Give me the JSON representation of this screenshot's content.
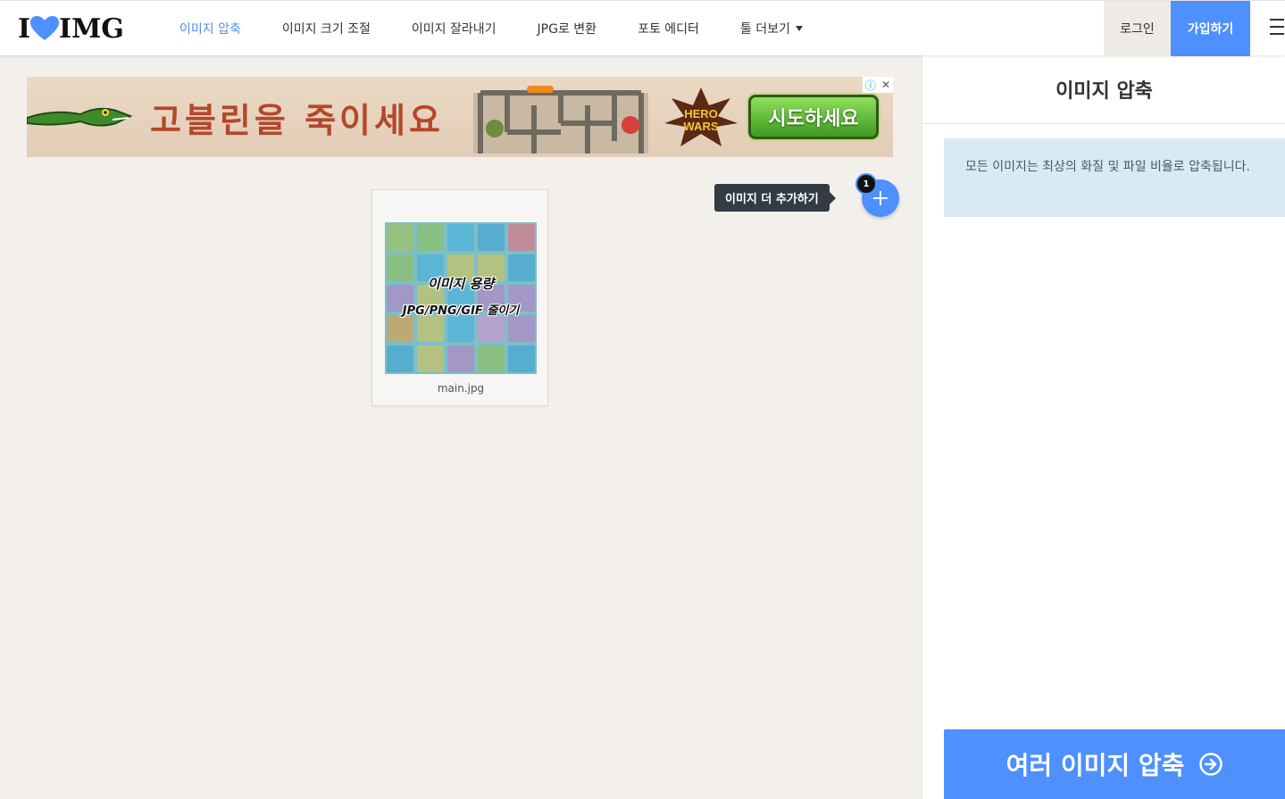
{
  "header": {
    "logo_left": "I",
    "logo_right": "IMG",
    "nav": [
      {
        "label": "이미지 압축",
        "active": true
      },
      {
        "label": "이미지 크기 조절",
        "active": false
      },
      {
        "label": "이미지 잘라내기",
        "active": false
      },
      {
        "label": "JPG로 변환",
        "active": false
      },
      {
        "label": "포토 에디터",
        "active": false
      },
      {
        "label": "툴 더보기",
        "active": false,
        "dropdown": true
      }
    ],
    "login_label": "로그인",
    "signup_label": "가입하기",
    "menu_icon": "hamburger-icon"
  },
  "ad": {
    "headline": "고블린을 죽이세요",
    "cta": "시도하세요",
    "brand": "HERO WARS"
  },
  "workspace": {
    "add_more_tooltip": "이미지 더 추가하기",
    "file_count": "1",
    "files": [
      {
        "name": "main.jpg",
        "thumb_line1": "이미지 용량",
        "thumb_line2": "JPG/PNG/GIF 줄이기"
      }
    ]
  },
  "sidebar": {
    "title": "이미지 압축",
    "info": "모든 이미지는 최상의 화질 및 파일 비율로 압축됩니다.",
    "action_label": "여러 이미지 압축"
  },
  "colors": {
    "accent": "#4d90fe",
    "nav_active": "#4a90e2",
    "info_bg": "#d8eaf3",
    "workspace_bg": "#f3f0ec"
  }
}
